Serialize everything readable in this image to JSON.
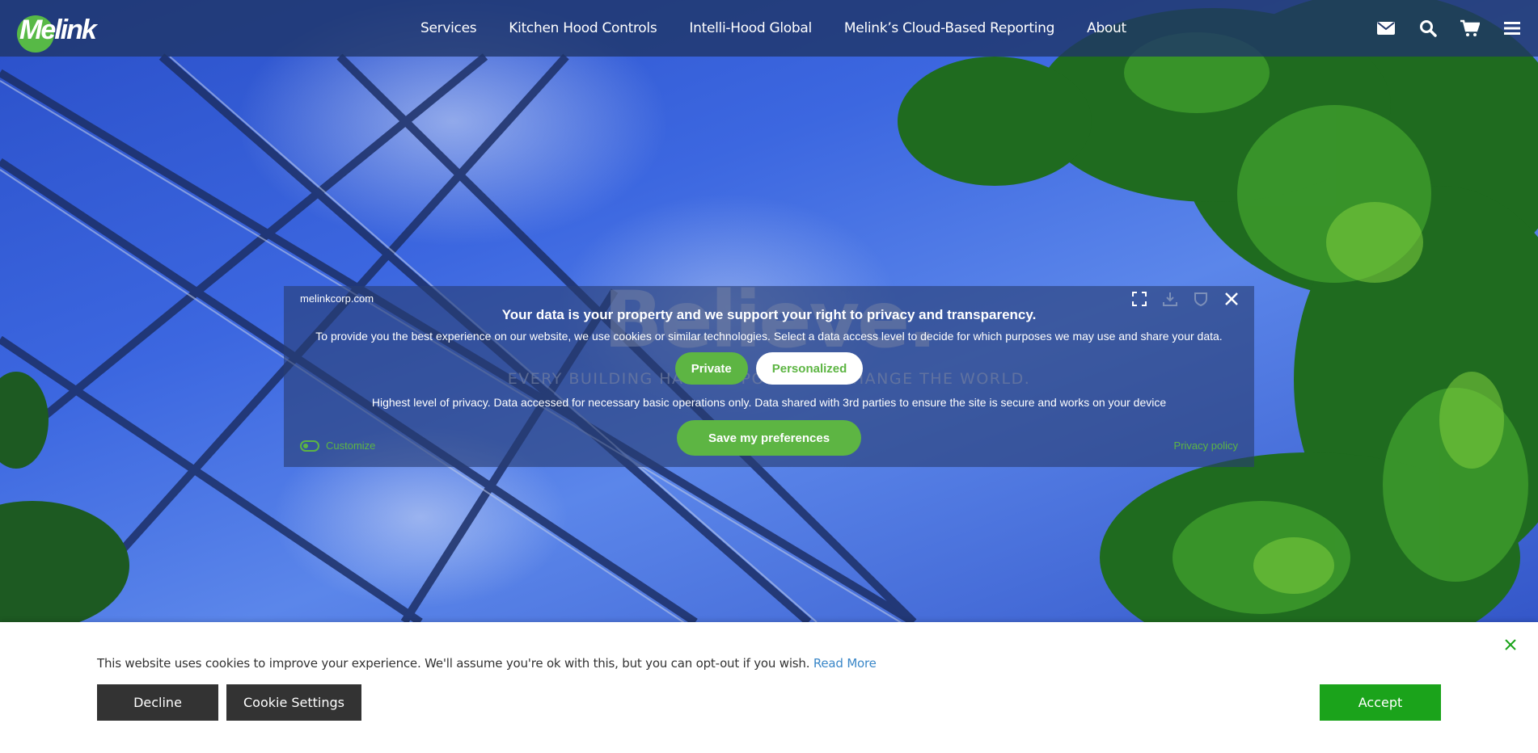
{
  "brand": {
    "logo_text": "Melink",
    "accent": "#57b946"
  },
  "nav": {
    "links": [
      "Services",
      "Kitchen Hood Controls",
      "Intelli-Hood Global",
      "Melink’s Cloud-Based Reporting",
      "About"
    ],
    "icons": [
      "envelope-icon",
      "search-icon",
      "cart-icon",
      "menu-icon"
    ]
  },
  "hero": {
    "title": "Believe.",
    "subtitle": "EVERY BUILDING HAS THE POWER TO CHANGE THE WORLD."
  },
  "privacy_modal": {
    "site": "melinkcorp.com",
    "heading": "Your data is your property and we support your right to privacy and transparency.",
    "description": "To provide you the best experience on our website, we use cookies or similar technologies. Select a data access level to decide for which purposes we may use and share your data.",
    "levels": [
      "Private",
      "Personalized"
    ],
    "level_description": "Highest level of privacy. Data accessed for necessary basic operations only. Data shared with 3rd parties to ensure the site is secure and works on your device",
    "save_label": "Save my preferences",
    "customize_label": "Customize",
    "privacy_policy_label": "Privacy policy",
    "button_color": "#5db543"
  },
  "cookie_bar": {
    "message": "This website uses cookies to improve your experience. We'll assume you're ok with this, but you can opt-out if you wish.",
    "read_more": "Read More",
    "decline_label": "Decline",
    "settings_label": "Cookie Settings",
    "accept_label": "Accept",
    "accept_color": "#1ba31b"
  }
}
